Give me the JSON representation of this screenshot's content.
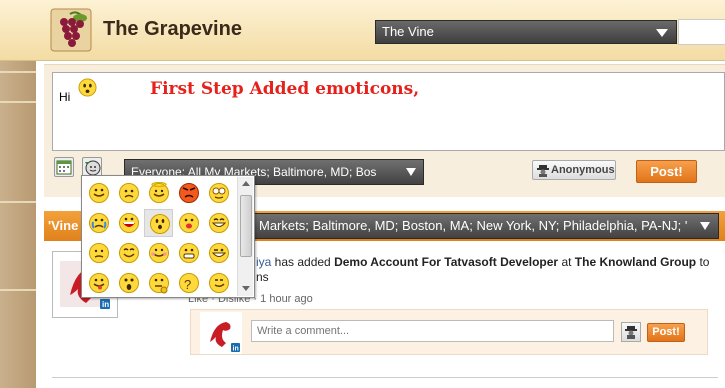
{
  "app": {
    "title": "The Grapevine"
  },
  "header": {
    "vine_select_value": "The Vine",
    "brand_color": "#e07b1c"
  },
  "composer": {
    "text": "Hi",
    "annotation": "First Step Added emoticons,",
    "audience_value": "Everyone: All My Markets; Baltimore, MD; Bos",
    "anonymous_label": "Anonymous",
    "post_label": "Post!"
  },
  "feed": {
    "label": "'Vine",
    "filter_value": "Markets; Baltimore, MD; Boston, MA; New York, NY; Philadelphia, PA-NJ; '",
    "story": {
      "name_fragment": "iya",
      "text_1": " has added ",
      "object": "Demo Account For Tatvasoft Developer",
      "text_2": " at ",
      "company": "The Knowland Group",
      "text_3": " to",
      "line2": "ns"
    },
    "meta": {
      "like": "Like",
      "dislike": "Dislike",
      "sep": " · ",
      "time": "1 hour ago"
    },
    "comment_placeholder": "Write a comment...",
    "comment_post_label": "Post!"
  },
  "emoticons": {
    "items": [
      {
        "name": "smile"
      },
      {
        "name": "frown"
      },
      {
        "name": "angel"
      },
      {
        "name": "angry"
      },
      {
        "name": "nerd"
      },
      {
        "name": "crying"
      },
      {
        "name": "big-grin"
      },
      {
        "name": "surprised"
      },
      {
        "name": "kiss"
      },
      {
        "name": "laugh"
      },
      {
        "name": "sad"
      },
      {
        "name": "happy"
      },
      {
        "name": "blush"
      },
      {
        "name": "grin"
      },
      {
        "name": "wink"
      },
      {
        "name": "tongue"
      },
      {
        "name": "shocked"
      },
      {
        "name": "thinking"
      },
      {
        "name": "confused"
      },
      {
        "name": "smirk"
      }
    ],
    "selected_index": 7
  }
}
